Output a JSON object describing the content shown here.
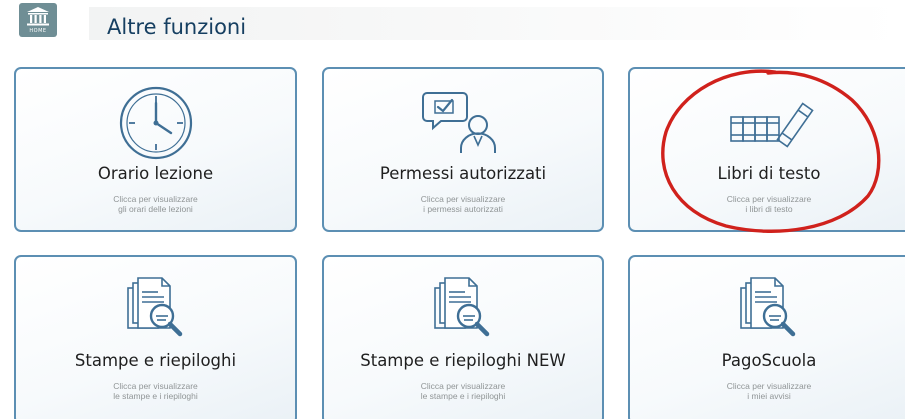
{
  "header": {
    "home_label": "HOME",
    "title": "Altre funzioni"
  },
  "tiles": [
    {
      "title": "Orario lezione",
      "desc_line1": "Clicca per visualizzare",
      "desc_line2": "gli orari delle lezioni",
      "icon": "clock-icon"
    },
    {
      "title": "Permessi autorizzati",
      "desc_line1": "Clicca per visualizzare",
      "desc_line2": "i permessi autorizzati",
      "icon": "permission-icon"
    },
    {
      "title": "Libri di testo",
      "desc_line1": "Clicca per visualizzare",
      "desc_line2": "i libri di testo",
      "icon": "books-icon"
    },
    {
      "title": "Stampe e riepiloghi",
      "desc_line1": "Clicca per visualizzare",
      "desc_line2": "le stampe e i riepiloghi",
      "icon": "documents-search-icon"
    },
    {
      "title": "Stampe e riepiloghi NEW",
      "desc_line1": "Clicca per visualizzare",
      "desc_line2": "le stampe e i riepiloghi",
      "icon": "documents-search-icon"
    },
    {
      "title": "PagoScuola",
      "desc_line1": "Clicca per visualizzare",
      "desc_line2": "i miei avvisi",
      "icon": "documents-search-icon"
    }
  ],
  "colors": {
    "tile_border": "#5c8fb3",
    "icon_stroke": "#3f6f95",
    "title_text": "#163f61",
    "annotation_circle": "#d0211c"
  }
}
